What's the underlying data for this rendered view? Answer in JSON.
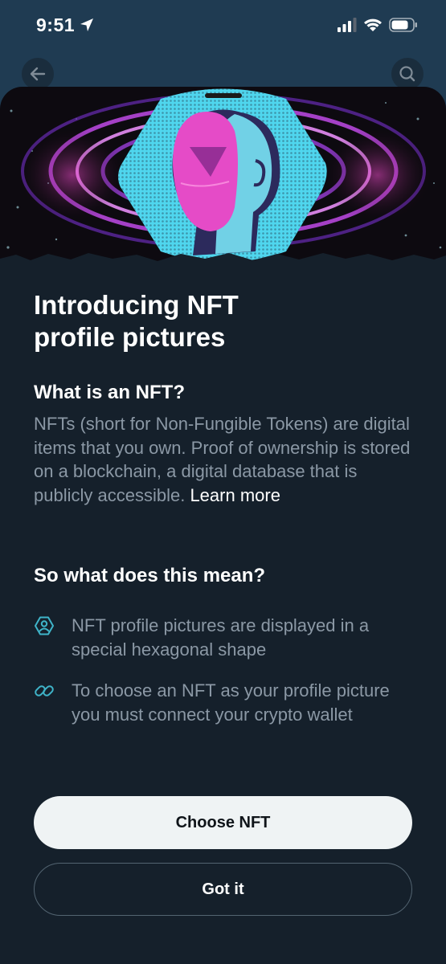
{
  "status_bar": {
    "time": "9:51"
  },
  "sheet": {
    "title_line1": "Introducing NFT",
    "title_line2": "profile pictures",
    "what_heading": "What is an NFT?",
    "what_body": "NFTs (short for Non-Fungible Tokens) are digital items that you own. Proof of ownership is stored on a blockchain, a digital database that is publicly accessible.",
    "learn_more": "Learn more",
    "meaning_heading": "So what does this mean?",
    "bullets": [
      {
        "icon": "hexagon-user-icon",
        "text": "NFT profile pictures are displayed in a special hexagonal shape"
      },
      {
        "icon": "link-icon",
        "text": "To choose an NFT as your profile picture you must connect your crypto wallet"
      }
    ],
    "choose_button": "Choose NFT",
    "got_it_button": "Got it"
  },
  "icons": {
    "back": "arrow-left-icon",
    "search": "search-icon",
    "location": "location-arrow-icon",
    "signal": "cellular-signal-icon",
    "wifi": "wifi-icon",
    "battery": "battery-icon"
  },
  "colors": {
    "sheet_bg": "#15202b",
    "body_text": "#8b98a5",
    "accent_teal": "#3fb4c9",
    "primary_button_bg": "#eff3f4",
    "secondary_button_border": "#536471"
  }
}
